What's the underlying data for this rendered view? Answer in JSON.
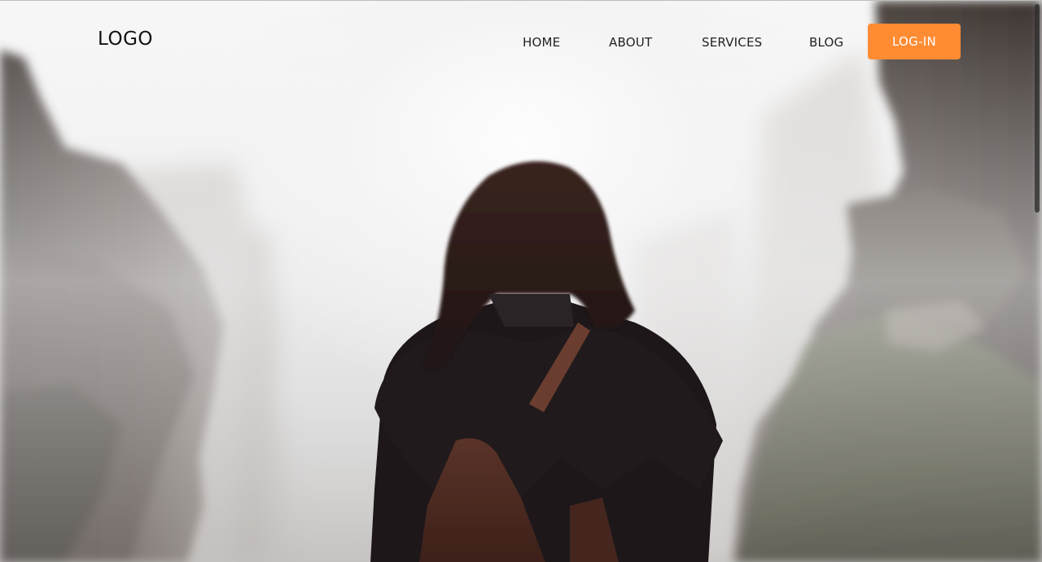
{
  "brand": {
    "logo_text": "LOGO"
  },
  "nav": {
    "links": [
      {
        "label": "HOME"
      },
      {
        "label": "ABOUT"
      },
      {
        "label": "SERVICES"
      },
      {
        "label": "BLOG"
      }
    ],
    "login_label": "LOG-IN"
  },
  "colors": {
    "accent": "#FF8C33",
    "nav_text": "#222222",
    "logo_text": "#111111"
  },
  "hero": {
    "image_icon": "hero-photo-woman-in-fog-canyon"
  }
}
